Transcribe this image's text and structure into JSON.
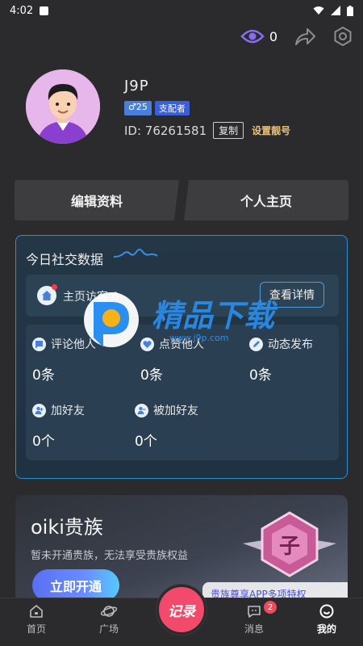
{
  "status_bar": {
    "time": "4:02"
  },
  "top_bar": {
    "view_count": "0"
  },
  "profile": {
    "username": "J9P",
    "age_badge": "♂25",
    "role_badge": "支配者",
    "id_text": "ID: 76261581",
    "copy_label": "复制",
    "pretty_id_label": "设置靓号"
  },
  "actions": {
    "edit_label": "编辑资料",
    "homepage_label": "个人主页"
  },
  "social": {
    "title": "今日社交数据",
    "home_visits_label": "主页访客 0",
    "detail_label": "查看详情",
    "stats": [
      {
        "label": "评论他人",
        "value": "0条"
      },
      {
        "label": "点赞他人",
        "value": "0条"
      },
      {
        "label": "动态发布",
        "value": "0条"
      },
      {
        "label": "加好友",
        "value": "0个"
      },
      {
        "label": "被加好友",
        "value": "0个"
      }
    ]
  },
  "watermark": {
    "text": "精品下载",
    "url": "www.j9p.com"
  },
  "noble": {
    "title": "oiki贵族",
    "subtitle": "暂未开通贵族，无法享受贵族权益",
    "button_label": "立即开通",
    "ribbon_text": "贵族尊享APP多项特权"
  },
  "tabbar": {
    "items": [
      {
        "label": "首页"
      },
      {
        "label": "广场"
      },
      {
        "label": "记录"
      },
      {
        "label": "消息",
        "badge": "2"
      },
      {
        "label": "我的"
      }
    ]
  },
  "colors": {
    "accent": "#2f8fd0",
    "record": "#f24a6a",
    "noble_button": "#5a6ff2"
  }
}
